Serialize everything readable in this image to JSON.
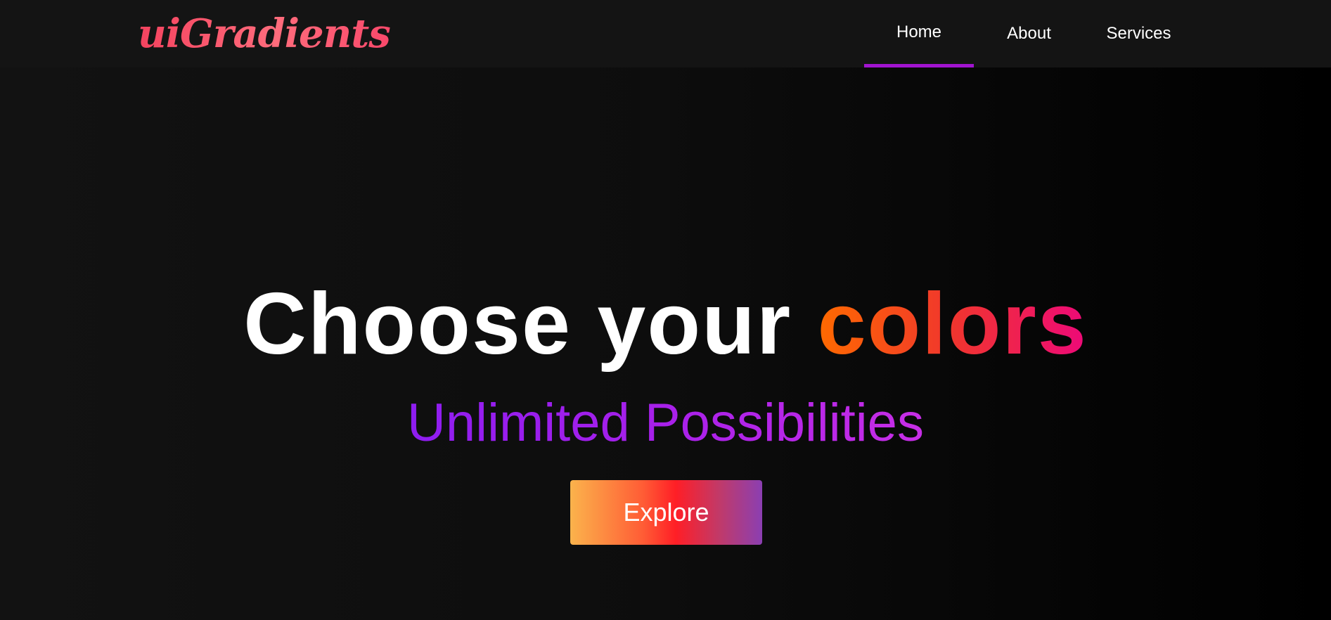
{
  "navbar": {
    "logo_text": "uiGradients",
    "links": [
      {
        "label": "Home",
        "active": true
      },
      {
        "label": "About",
        "active": false
      },
      {
        "label": "Services",
        "active": false
      }
    ]
  },
  "hero": {
    "title_main": "Choose your ",
    "title_accent": "colors",
    "subtitle": "Unlimited Possibilities",
    "button_label": "Explore"
  },
  "colors": {
    "background": "#121212",
    "navbar_background": "#141414",
    "active_underline": "#a114d0",
    "logo_gradient": [
      "#f4435f",
      "#ff6c7c"
    ],
    "title_accent_gradient": [
      "#ff6a00",
      "#ee0979"
    ],
    "subtitle_gradient": [
      "#8e1df0",
      "#c72ee6"
    ],
    "button_gradient": [
      "#fbb34c",
      "#ff1e26",
      "#8b3fb2"
    ]
  }
}
